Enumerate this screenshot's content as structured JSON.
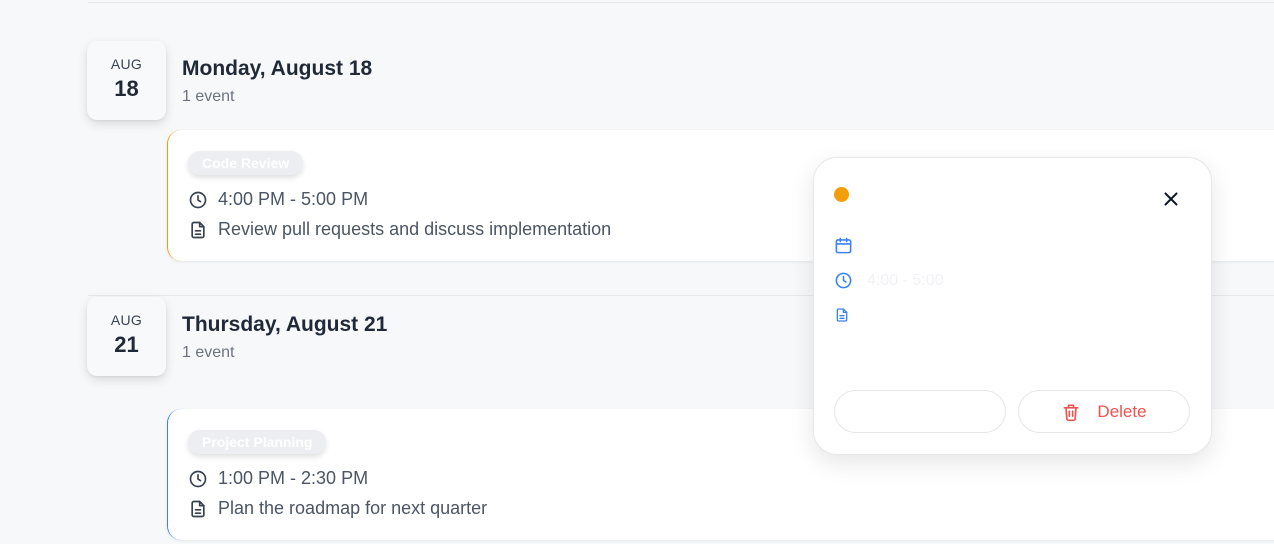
{
  "days": [
    {
      "badge_month": "AUG",
      "badge_day": "18",
      "title": "Monday, August 18",
      "count": "1 event",
      "event": {
        "tag": "Code Review",
        "time": "4:00 PM - 5:00 PM",
        "description": "Review pull requests and discuss implementation",
        "color": "#f59e0b"
      }
    },
    {
      "badge_month": "AUG",
      "badge_day": "21",
      "title": "Thursday, August 21",
      "count": "1 event",
      "event": {
        "tag": "Project Planning",
        "time": "1:00 PM - 2:30 PM",
        "description": "Plan the roadmap for next quarter",
        "color": "#3b82f6"
      }
    }
  ],
  "popup": {
    "accent_color": "#f59e0b",
    "time": "4:00 - 5:00",
    "delete_label": "Delete",
    "icons": [
      "calendar-icon",
      "clock-icon",
      "document-icon",
      "close-icon",
      "trash-icon"
    ]
  }
}
